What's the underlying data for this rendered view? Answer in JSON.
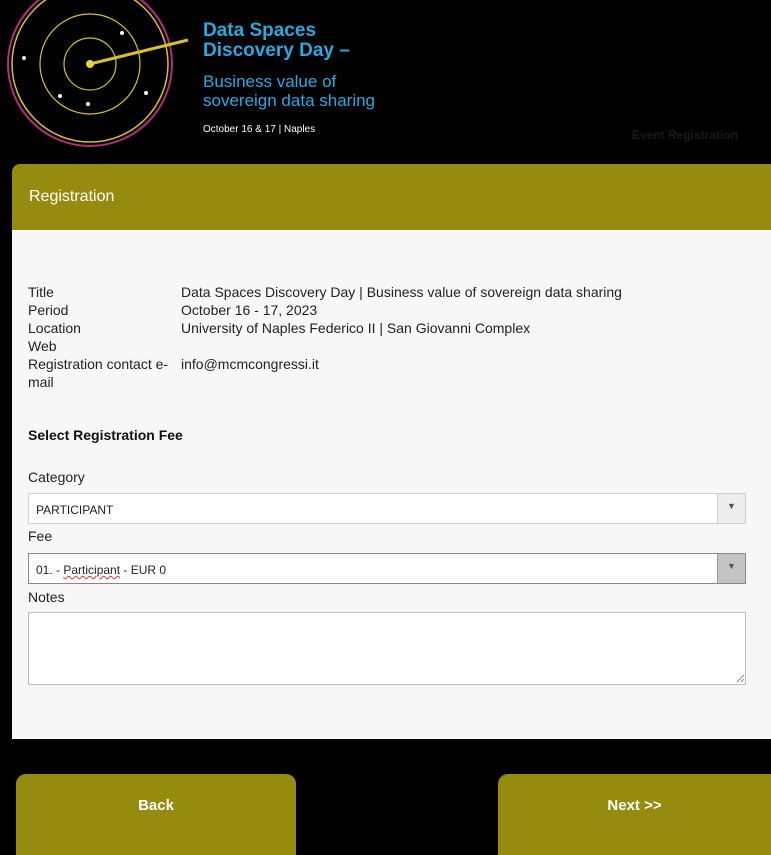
{
  "banner": {
    "title_line1": "Data Spaces",
    "title_line2": "Discovery Day –",
    "subtitle_line1": "Business value of",
    "subtitle_line2": "sovereign data sharing",
    "date_place": "October 16 & 17 | Naples",
    "right_text": "Event Registration",
    "logo_icon": "radar-target-icon",
    "accent_color": "#29a9e0"
  },
  "registration": {
    "header": "Registration",
    "header_color": "#958b0e",
    "info": [
      {
        "label": "Title",
        "value": "Data Spaces Discovery Day | Business value of sovereign data sharing"
      },
      {
        "label": "Period",
        "value": "October 16 - 17, 2023"
      },
      {
        "label": "Location",
        "value": "University of Naples Federico II | San Giovanni Complex"
      },
      {
        "label": "Web",
        "value": ""
      },
      {
        "label": "Registration contact e-mail",
        "value": "info@mcmcongressi.it"
      }
    ],
    "fee_section_title": "Select Registration Fee",
    "category_label": "Category",
    "category_value": "PARTICIPANT",
    "fee_label": "Fee",
    "fee_value_prefix": "01. - ",
    "fee_value_word": "Participant",
    "fee_value_suffix": " - EUR 0",
    "notes_label": "Notes",
    "notes_value": ""
  },
  "buttons": {
    "back": "Back",
    "next": "Next >>"
  }
}
